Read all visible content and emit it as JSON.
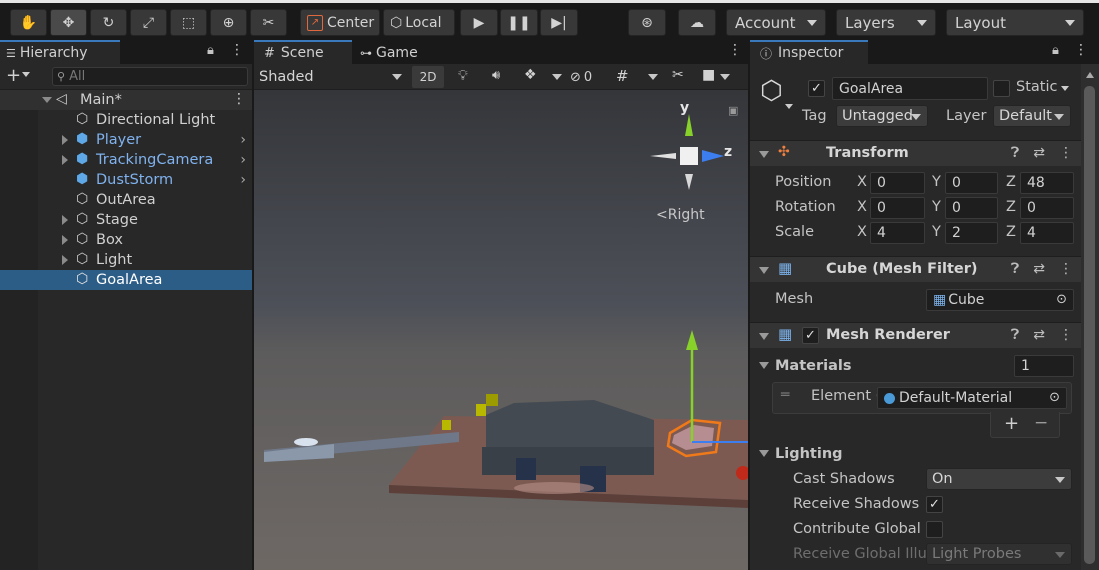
{
  "toolbar": {
    "pivot_mode": "Center",
    "pivot_space": "Local",
    "account": "Account",
    "layers": "Layers",
    "layout": "Layout"
  },
  "hierarchy": {
    "tab": "Hierarchy",
    "search_placeholder": "All",
    "scene_name": "Main*",
    "items": [
      {
        "label": "Directional Light"
      },
      {
        "label": "Player"
      },
      {
        "label": "TrackingCamera"
      },
      {
        "label": "DustStorm"
      },
      {
        "label": "OutArea"
      },
      {
        "label": "Stage"
      },
      {
        "label": "Box"
      },
      {
        "label": "Light"
      },
      {
        "label": "GoalArea"
      }
    ]
  },
  "scene": {
    "tab_scene": "Scene",
    "tab_game": "Game",
    "draw_mode": "Shaded",
    "mode_2d": "2D",
    "hidden_count": "0",
    "gizmo_y": "y",
    "gizmo_z": "z",
    "view_label": "Right"
  },
  "inspector": {
    "tab": "Inspector",
    "object_name": "GoalArea",
    "static_label": "Static",
    "tag_label": "Tag",
    "tag_value": "Untagged",
    "layer_label": "Layer",
    "layer_value": "Default",
    "transform": {
      "title": "Transform",
      "position_label": "Position",
      "rotation_label": "Rotation",
      "scale_label": "Scale",
      "axis_x": "X",
      "axis_y": "Y",
      "axis_z": "Z",
      "position": {
        "x": "0",
        "y": "0",
        "z": "48"
      },
      "rotation": {
        "x": "0",
        "y": "0",
        "z": "0"
      },
      "scale": {
        "x": "4",
        "y": "2",
        "z": "4"
      }
    },
    "mesh_filter": {
      "title": "Cube (Mesh Filter)",
      "mesh_label": "Mesh",
      "mesh_value": "Cube"
    },
    "mesh_renderer": {
      "title": "Mesh Renderer",
      "materials_label": "Materials",
      "materials_count": "1",
      "element_label": "Element (",
      "element_value": "Default-Material",
      "add": "+",
      "remove": "−"
    },
    "lighting": {
      "title": "Lighting",
      "cast_shadows_label": "Cast Shadows",
      "cast_shadows_value": "On",
      "receive_shadows_label": "Receive Shadows",
      "contribute_global_label": "Contribute Global",
      "receive_global_label": "Receive Global Illu",
      "receive_global_value": "Light Probes"
    }
  }
}
